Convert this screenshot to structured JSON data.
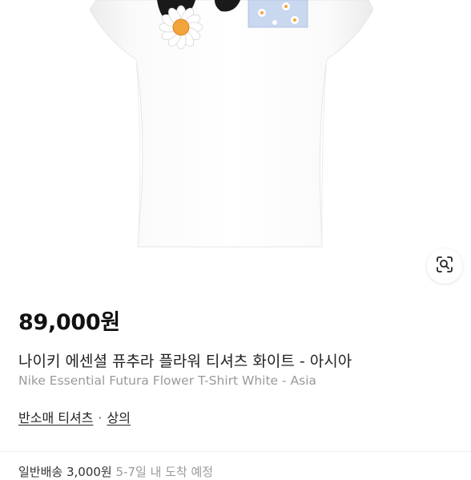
{
  "product": {
    "price": "89,000원",
    "title_ko": "나이키 에센셜 퓨추라 플라워 티셔츠 화이트 - 아시아",
    "title_en": "Nike Essential Futura Flower T-Shirt White - Asia"
  },
  "category": {
    "sub": "반소매 티셔츠",
    "separator": "·",
    "main": "상의"
  },
  "shipping": {
    "text": "일반배송 3,000원",
    "extra": "5-7일 내 도착 예정"
  },
  "icons": {
    "lens": "image-search-lens-icon"
  },
  "colors": {
    "shirt": "#ffffff",
    "swoosh": "#1a1a1a",
    "pocket": "#c9d7ef",
    "petal": "#ffffff",
    "flower_center": "#f2a33a"
  }
}
